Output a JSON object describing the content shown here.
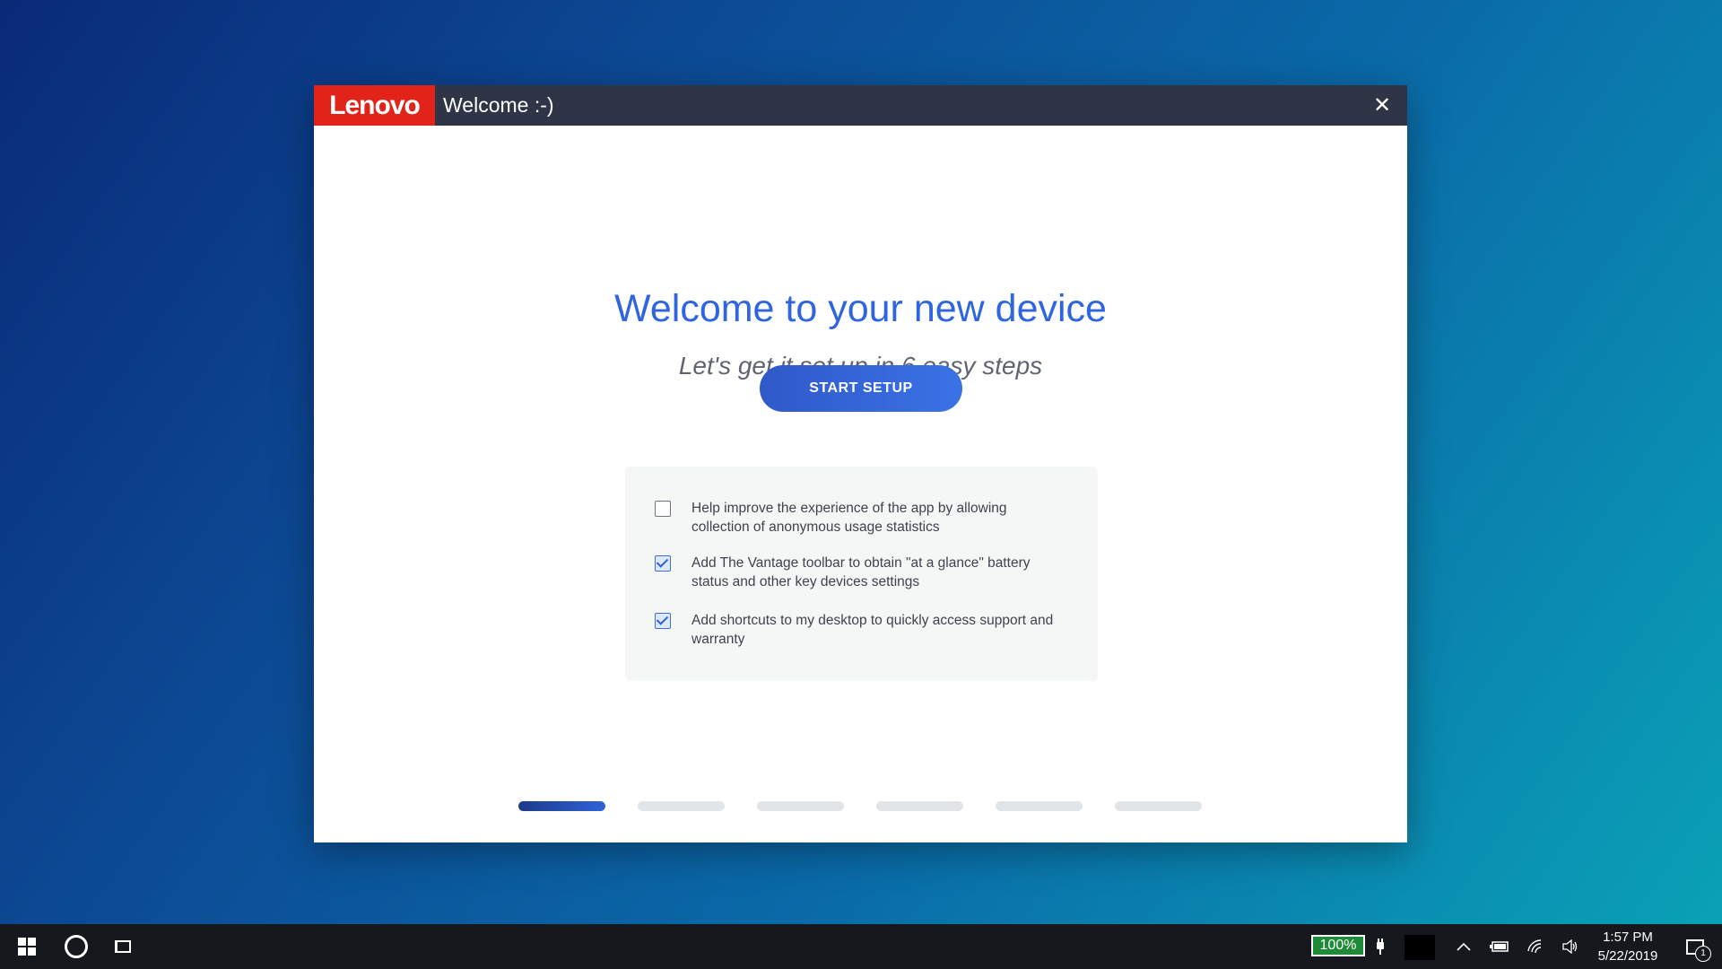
{
  "dialog": {
    "brand": "Lenovo",
    "title": "Welcome :-)",
    "close_glyph": "✕",
    "headline": "Welcome to your new device",
    "subheadline": "Let's get it set up in 6 easy steps",
    "start_button": "START SETUP",
    "options": [
      {
        "label": "Help improve the experience of the app by allowing collection of anonymous usage statistics",
        "checked": false
      },
      {
        "label": "Add The Vantage toolbar to obtain \"at a glance\" battery status and other key devices settings",
        "checked": true
      },
      {
        "label": "Add shortcuts to my desktop to quickly access support and warranty",
        "checked": true
      }
    ],
    "steps": {
      "total": 6,
      "current": 1
    }
  },
  "taskbar": {
    "battery": "100%",
    "time": "1:57 PM",
    "date": "5/22/2019",
    "notification_count": "1",
    "icons": [
      "windows-start-icon",
      "cortana-icon",
      "task-view-icon",
      "plug-icon",
      "chevron-up-icon",
      "battery-icon",
      "wifi-icon",
      "volume-icon",
      "notification-icon"
    ]
  },
  "colors": {
    "accent": "#2f66df",
    "brand_red": "#e2231a",
    "titlebar": "#2f3546",
    "battery_green": "#1f8a38"
  }
}
